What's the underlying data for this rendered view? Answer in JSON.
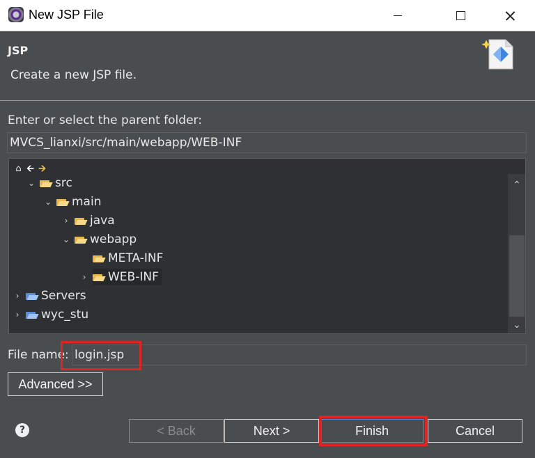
{
  "window": {
    "title": "New JSP File"
  },
  "banner": {
    "title": "JSP",
    "description": "Create a new JSP file."
  },
  "parent": {
    "label": "Enter or select the parent folder:",
    "value": "MVCS_lianxi/src/main/webapp/WEB-INF"
  },
  "tree": {
    "items": [
      {
        "label": "src",
        "expanded": true
      },
      {
        "label": "main",
        "expanded": true
      },
      {
        "label": "java",
        "expanded": false
      },
      {
        "label": "webapp",
        "expanded": true
      },
      {
        "label": "META-INF"
      },
      {
        "label": "WEB-INF",
        "expanded": false,
        "selected": true
      },
      {
        "label": "Servers",
        "expanded": false
      },
      {
        "label": "wyc_stu",
        "expanded": false
      }
    ]
  },
  "filename": {
    "label": "File name:",
    "value": "login.jsp"
  },
  "buttons": {
    "advanced": "Advanced >>",
    "back": "< Back",
    "next": "Next >",
    "finish": "Finish",
    "cancel": "Cancel"
  },
  "icons": {
    "help": "?"
  },
  "colors": {
    "highlight": "#e02424",
    "accent": "#4b8ad6",
    "background": "#4a4d50"
  }
}
